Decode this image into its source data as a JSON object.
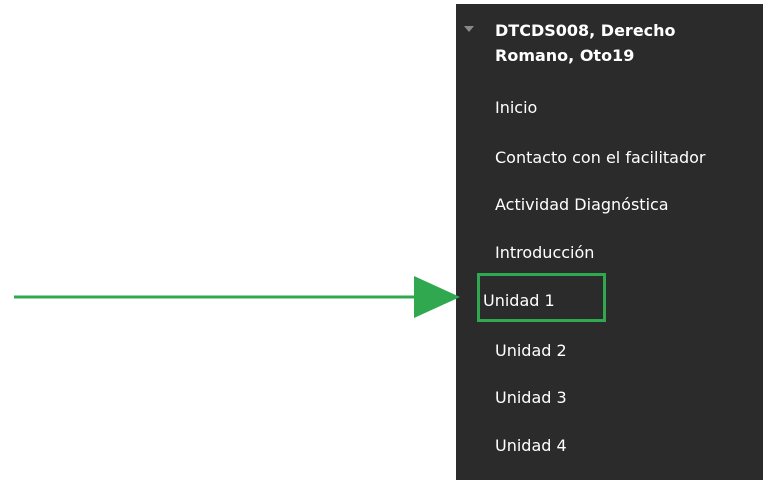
{
  "course_menu": {
    "title": "DTCDS008, Derecho Romano, Oto19",
    "items": [
      {
        "label": "Inicio"
      },
      {
        "label": "Contacto con el facilitador"
      },
      {
        "label": "Actividad Diagnóstica"
      },
      {
        "label": "Introducción"
      },
      {
        "label": "Unidad 1"
      },
      {
        "label": "Unidad 2"
      },
      {
        "label": "Unidad 3"
      },
      {
        "label": "Unidad 4"
      }
    ]
  },
  "annotation": {
    "highlighted_item": "Unidad 1",
    "color": "#2fa84f"
  },
  "colors": {
    "menu_background": "#2b2b2b",
    "menu_text": "#ffffff",
    "accent": "#2fa84f"
  },
  "icons": {
    "collapse": "triangle-down-icon"
  }
}
